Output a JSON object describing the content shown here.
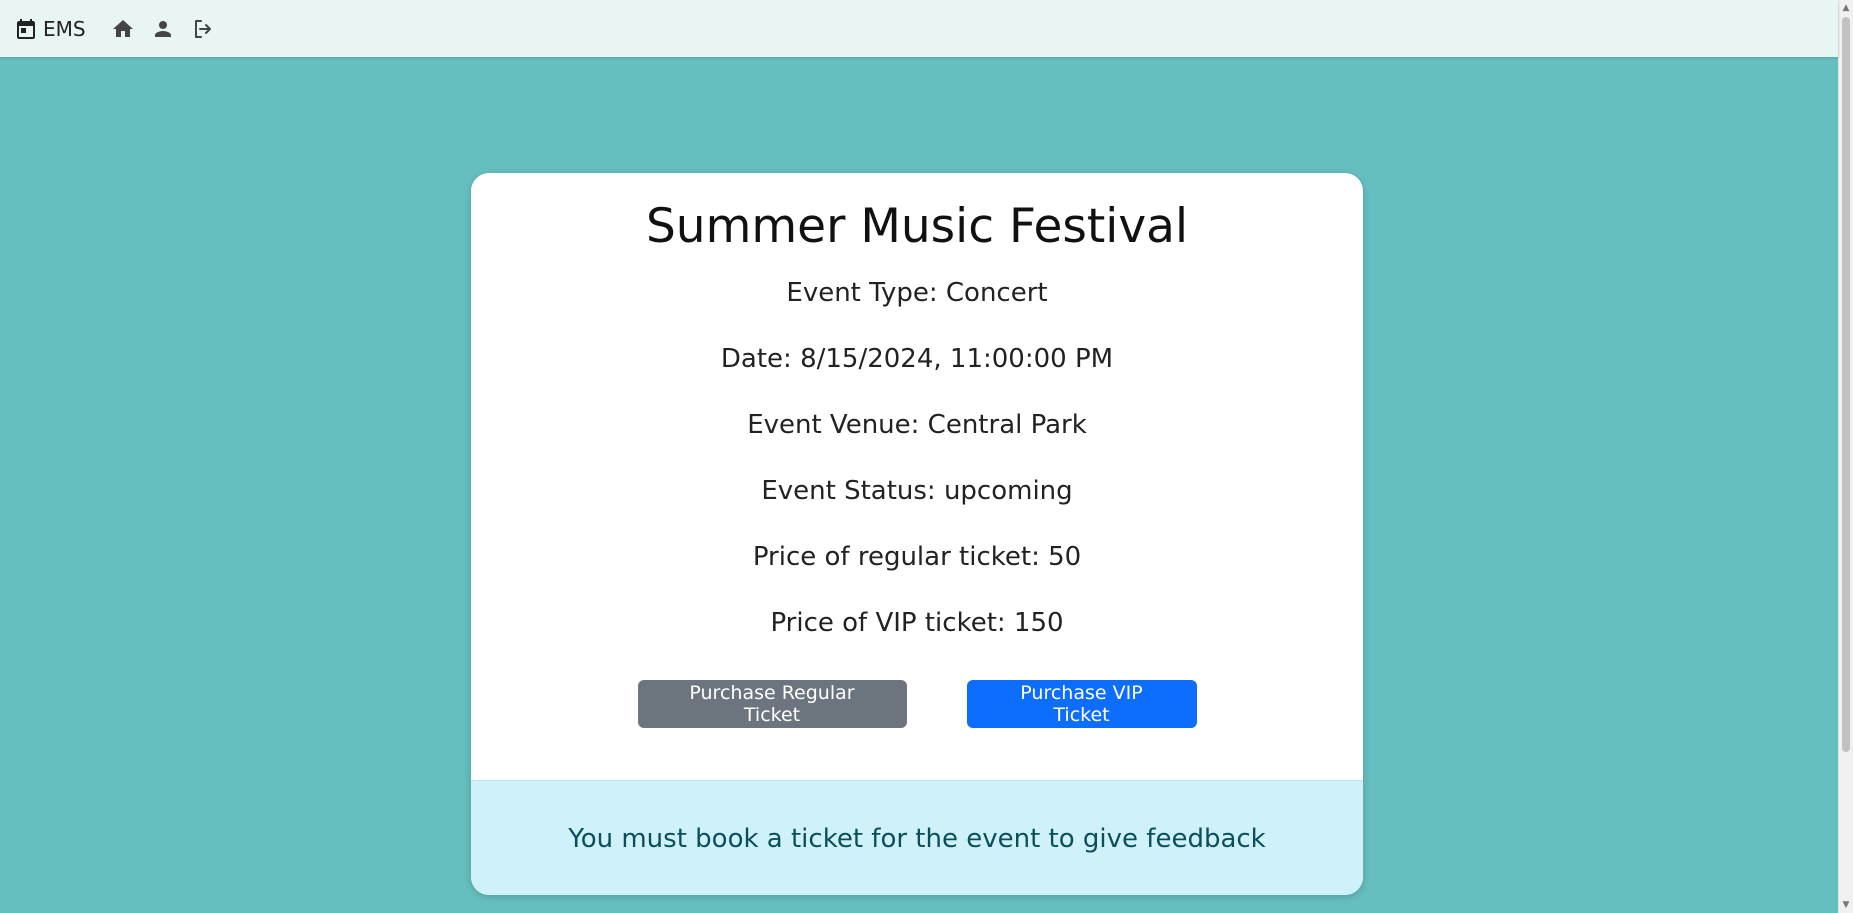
{
  "navbar": {
    "brand_label": "EMS",
    "icons": [
      "calendar-icon",
      "home-icon",
      "person-icon",
      "logout-icon"
    ]
  },
  "event": {
    "title": "Summer Music Festival",
    "type_line": "Event Type: Concert",
    "date_line": "Date: 8/15/2024, 11:00:00 PM",
    "venue_line": "Event Venue: Central Park",
    "status_line": "Event Status: upcoming",
    "regular_price_line": "Price of regular ticket: 50",
    "vip_price_line": "Price of VIP ticket: 150"
  },
  "actions": {
    "regular_label": "Purchase Regular Ticket",
    "vip_label": "Purchase VIP Ticket"
  },
  "feedback": {
    "message": "You must book a ticket for the event to give feedback"
  },
  "colors": {
    "background": "#66bfbf",
    "navbar": "#e9f5f5",
    "regular_button": "#6c757d",
    "vip_button": "#0d6efd",
    "feedback_bg": "#cff2fa",
    "feedback_text": "#0b4f5c"
  }
}
